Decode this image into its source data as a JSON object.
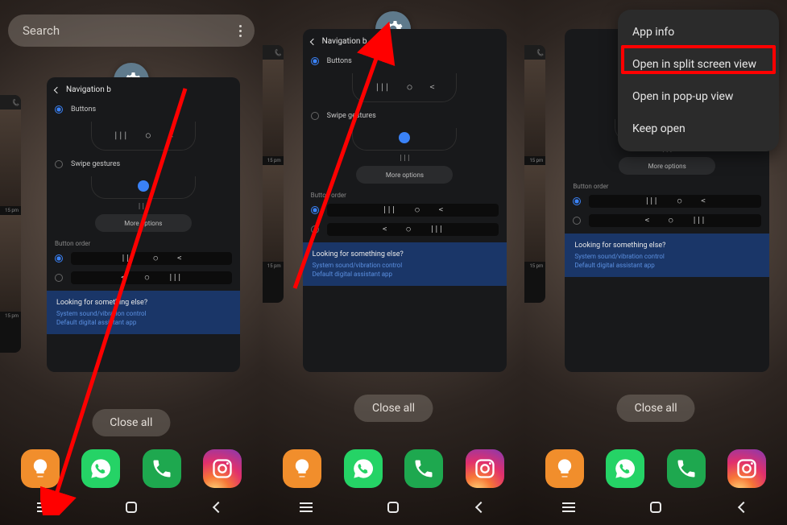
{
  "search_placeholder": "Search",
  "app_title": "Navigation b",
  "opt_buttons": "Buttons",
  "opt_swipe": "Swipe gestures",
  "more_options": "More options",
  "button_order": "Button order",
  "banner_q": "Looking for something else?",
  "banner_l1": "System sound/vibration control",
  "banner_l2": "Default digital assistant app",
  "close_all": "Close all",
  "peek_time": "15 pm",
  "nav_glyphs": {
    "recents": "|||",
    "home": "◻",
    "back": "<"
  },
  "bar_glyphs": {
    "a": "|||",
    "b": "○",
    "c": "<"
  },
  "alt_bar_glyphs": {
    "a": "<",
    "b": "○",
    "c": "|||"
  },
  "popup": {
    "app_info": "App info",
    "split": "Open in split screen view",
    "popup_view": "Open in pop-up view",
    "keep": "Keep open"
  },
  "icons": {
    "settings": "gear",
    "bulb": "bulb",
    "whatsapp": "wa",
    "phone": "phone",
    "instagram": "ig"
  }
}
